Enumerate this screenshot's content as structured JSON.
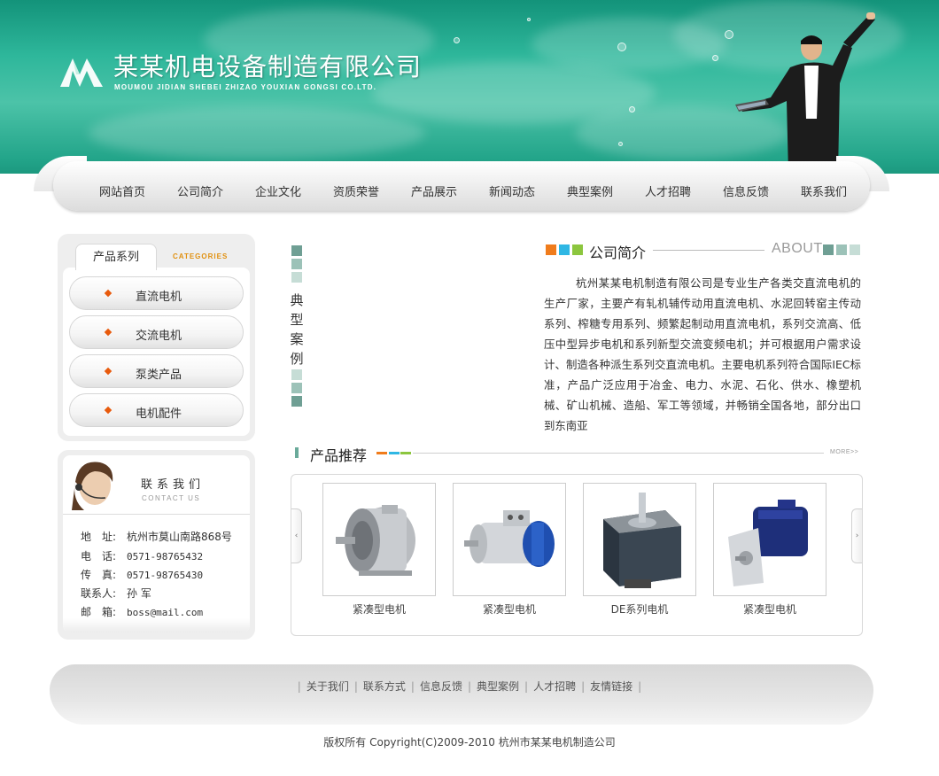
{
  "header": {
    "company_name": "某某机电设备制造有限公司",
    "company_pinyin": "MOUMOU JIDIAN SHEBEI ZHIZAO YOUXIAN GONGSI CO.LTD.",
    "brand_color": "#1fa287"
  },
  "nav": {
    "items": [
      "网站首页",
      "公司简介",
      "企业文化",
      "资质荣誉",
      "产品展示",
      "新闻动态",
      "典型案例",
      "人才招聘",
      "信息反馈",
      "联系我们"
    ]
  },
  "categories": {
    "tab_label": "产品系列",
    "tab_en": "CATEGORIES",
    "items": [
      "直流电机",
      "交流电机",
      "泵类产品",
      "电机配件"
    ]
  },
  "contact": {
    "title": "联系我们",
    "title_en": "CONTACT US",
    "rows": [
      {
        "key": "地　址:",
        "value": "杭州市莫山南路868号"
      },
      {
        "key": "电　话:",
        "value": "0571-98765432"
      },
      {
        "key": "传　真:",
        "value": "0571-98765430"
      },
      {
        "key": "联系人:",
        "value": "孙 军"
      },
      {
        "key": "邮　箱:",
        "value": "boss@mail.com"
      }
    ]
  },
  "cases": {
    "title": "典型案例"
  },
  "about": {
    "title": "公司简介",
    "title_en": "ABOUT",
    "text": "杭州某某电机制造有限公司是专业生产各类交直流电机的生产厂家，主要产有轧机辅传动用直流电机、水泥回转窑主传动系列、榨糖专用系列、频繁起制动用直流电机，系列交流高、低压中型异步电机和系列新型交流变频电机；并可根据用户需求设计、制造各种派生系列交直流电机。主要电机系列符合国际IEC标准，产品广泛应用于冶金、电力、水泥、石化、供水、橡塑机械、矿山机械、造船、军工等领域，并畅销全国各地，部分出口到东南亚"
  },
  "products": {
    "title": "产品推荐",
    "more": "MORE>>",
    "items": [
      {
        "name": "紧凑型电机"
      },
      {
        "name": "紧凑型电机"
      },
      {
        "name": "DE系列电机"
      },
      {
        "name": "紧凑型电机"
      }
    ]
  },
  "footer": {
    "links": [
      "关于我们",
      "联系方式",
      "信息反馈",
      "典型案例",
      "人才招聘",
      "友情链接"
    ],
    "copyright": "版权所有  Copyright(C)2009-2010 杭州市某某电机制造公司"
  }
}
